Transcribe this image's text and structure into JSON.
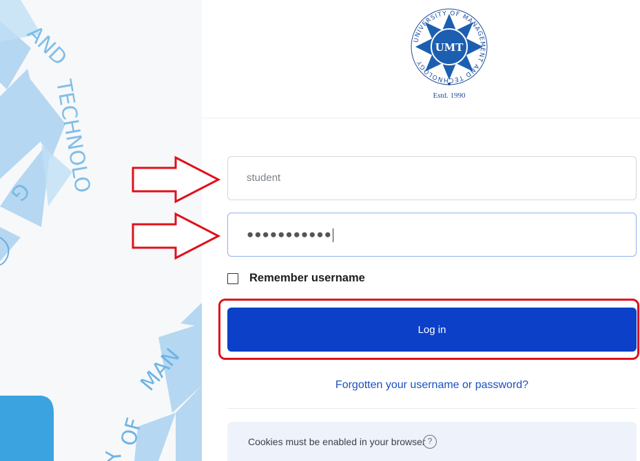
{
  "logo": {
    "emblem_text": "UMT",
    "ring_text": "UNIVERSITY OF MANAGEMENT AND TECHNOLOGY",
    "established": "Estd. 1990"
  },
  "login_form": {
    "username_value": "student",
    "password_masked": "●●●●●●●●●●●",
    "remember_label": "Remember username",
    "login_button": "Log in",
    "forgot_link": "Forgotten your username or password?"
  },
  "cookie_notice": {
    "text": "Cookies must be enabled in your browser",
    "help_icon": "?"
  },
  "annotations": {
    "arrow_color": "#e0101a",
    "highlight_color": "#e0101a"
  },
  "colors": {
    "primary_button": "#0c40c8",
    "link": "#1a4fbf",
    "watermark": "#8cc4ea"
  }
}
